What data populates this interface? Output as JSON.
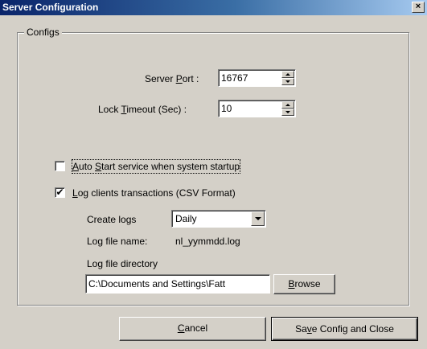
{
  "window": {
    "title": "Server Configuration",
    "close_glyph": "×"
  },
  "configs": {
    "legend": "Configs",
    "server_port": {
      "label_pre": "Server ",
      "label_accel": "P",
      "label_post": "ort :",
      "value": "16767"
    },
    "lock_timeout": {
      "label_pre": "Lock ",
      "label_accel": "T",
      "label_post": "imeout (Sec) :",
      "value": "10"
    },
    "auto_start": {
      "checked": false,
      "label_accel": "A",
      "label_post": "uto ",
      "label_accel2": "S",
      "label_post2": "tart service when system startup"
    },
    "log_clients": {
      "checked": true,
      "check_glyph": "✔",
      "label_accel": "L",
      "label_post": "og clients transactions (CSV Format)"
    },
    "create_logs": {
      "label": "Create logs",
      "value": "Daily"
    },
    "log_file_name": {
      "label": "Log file name:",
      "value": "nl_yymmdd.log"
    },
    "log_file_directory": {
      "label": "Log file directory",
      "value": "C:\\Documents and Settings\\Fatt"
    },
    "browse_button": {
      "label_accel": "B",
      "label_post": "rowse"
    }
  },
  "footer": {
    "cancel": {
      "label_accel": "C",
      "label_post": "ancel"
    },
    "save": {
      "label_pre": "Sa",
      "label_accel": "v",
      "label_post": "e Config and Close"
    }
  },
  "icons": {
    "spin_up": "spin-up-arrow-icon",
    "spin_down": "spin-down-arrow-icon",
    "dropdown": "dropdown-arrow-icon",
    "close": "close-icon",
    "check": "checkmark-icon"
  },
  "colors": {
    "title_start": "#0a246a",
    "title_end": "#a6caf0",
    "face": "#d4d0c8"
  }
}
